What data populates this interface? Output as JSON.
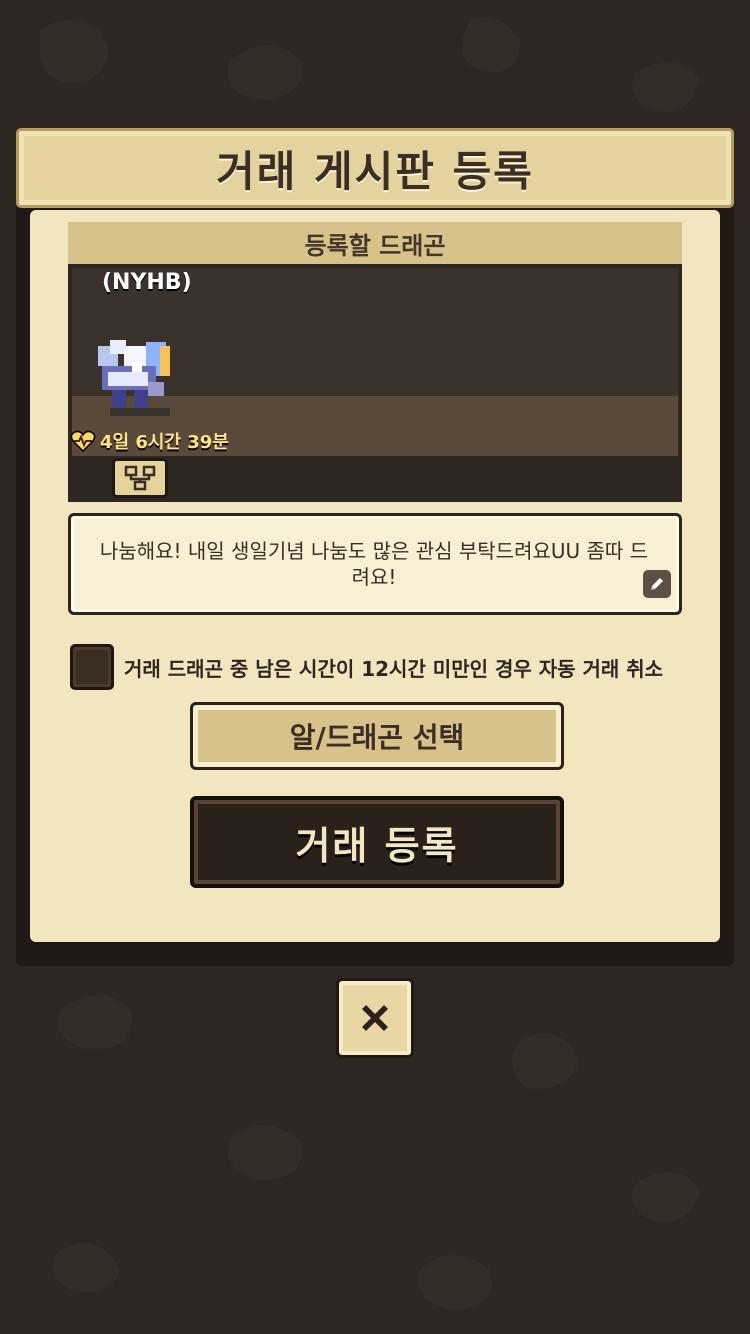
{
  "dialog": {
    "title": "거래 게시판 등록",
    "section_label": "등록할 드래곤"
  },
  "dragon": {
    "name": "(NYHB)",
    "timer": "4일 6시간 39분",
    "sprite_icon": "dragon-sprite",
    "timer_icon": "heart-pulse-icon",
    "tree_icon": "family-tree-icon"
  },
  "message": {
    "text": "나눔해요! 내일 생일기념 나눔도 많은 관심 부탁드려요UU 좀따 드려요!",
    "edit_icon": "pencil-icon"
  },
  "auto_cancel": {
    "label": "거래 드래곤 중 남은 시간이 12시간 미만인 경우 자동 거래 취소",
    "checked": false
  },
  "buttons": {
    "select": "알/드래곤 선택",
    "register": "거래 등록",
    "close_icon": "close-icon"
  },
  "colors": {
    "background": "#2e2622",
    "panel": "#f1e6bf",
    "header": "#e4d29f",
    "accent_gold": "#ffe28a",
    "dark_button": "#2a211b"
  }
}
